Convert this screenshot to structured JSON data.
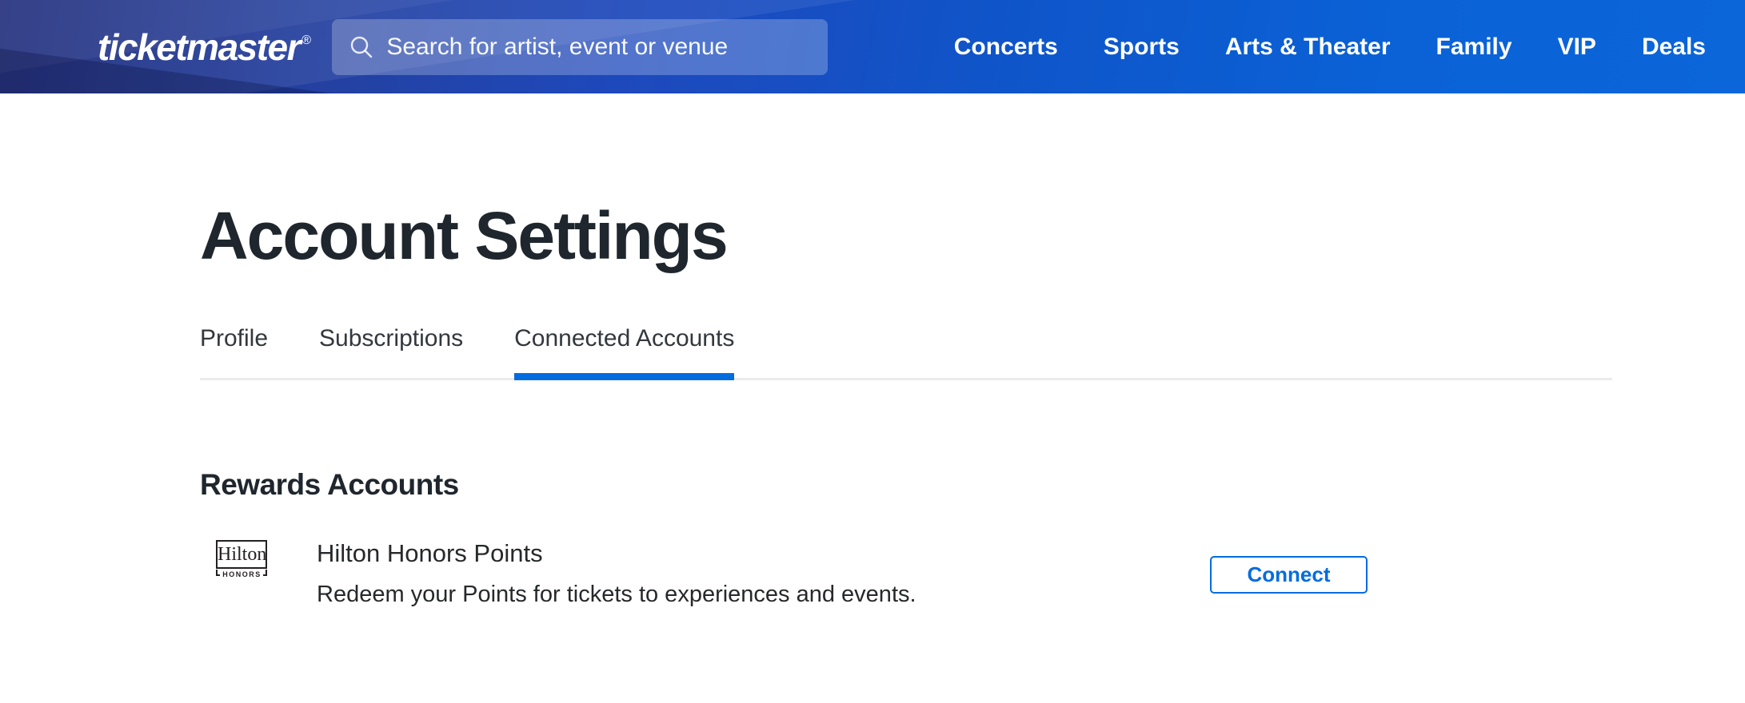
{
  "header": {
    "logo_text": "ticketmaster",
    "logo_mark": "®",
    "search": {
      "placeholder": "Search for artist, event or venue",
      "value": ""
    },
    "nav": [
      {
        "label": "Concerts"
      },
      {
        "label": "Sports"
      },
      {
        "label": "Arts & Theater"
      },
      {
        "label": "Family"
      },
      {
        "label": "VIP"
      },
      {
        "label": "Deals"
      }
    ]
  },
  "page": {
    "title": "Account Settings",
    "tabs": [
      {
        "label": "Profile",
        "active": false
      },
      {
        "label": "Subscriptions",
        "active": false
      },
      {
        "label": "Connected Accounts",
        "active": true
      }
    ]
  },
  "rewards": {
    "heading": "Rewards Accounts",
    "items": [
      {
        "logo_brand": "Hilton",
        "logo_sub": "HONORS",
        "title": "Hilton Honors Points",
        "description": "Redeem your Points for tickets to experiences and events.",
        "action_label": "Connect"
      }
    ]
  },
  "colors": {
    "accent_blue": "#026cdf",
    "header_gradient_left": "#1c2878",
    "header_gradient_right": "#0b66da",
    "text_dark": "#1f262d",
    "divider_gray": "#ebebeb"
  }
}
